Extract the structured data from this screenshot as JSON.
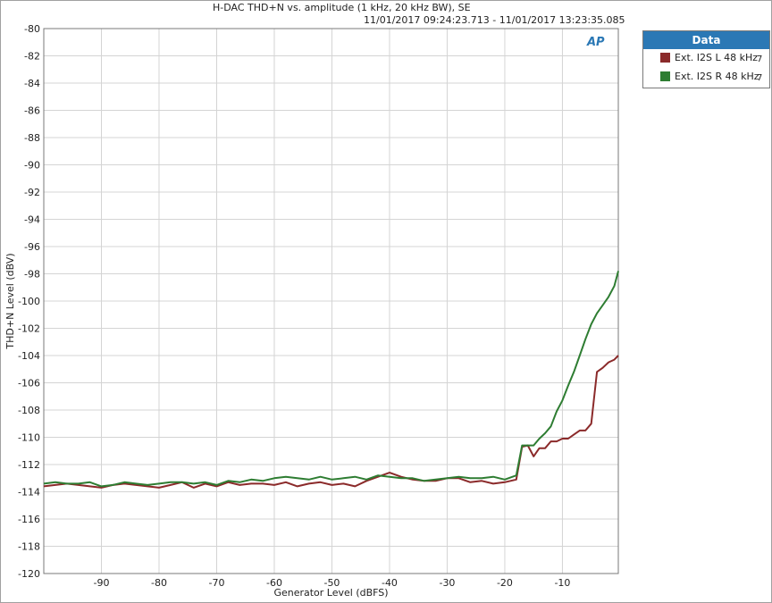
{
  "title": "H-DAC THD+N vs. amplitude (1 kHz, 20 kHz BW), SE",
  "subtitle": "11/01/2017 09:24:23.713 - 11/01/2017 13:23:35.085",
  "logo_text": "AP",
  "legend": {
    "header": "Data",
    "items": [
      {
        "label": "Ext. I2S L 48 kHz",
        "num": "7",
        "color": "#8b2a2a"
      },
      {
        "label": "Ext. I2S R 48 kHz",
        "num": "7",
        "color": "#2e7d32"
      }
    ]
  },
  "chart_data": {
    "type": "line",
    "title": "H-DAC THD+N vs. amplitude (1 kHz, 20 kHz BW), SE",
    "xlabel": "Generator Level (dBFS)",
    "ylabel": "THD+N Level (dBV)",
    "xlim": [
      -100,
      -0.3
    ],
    "ylim": [
      -120,
      -80
    ],
    "xticks": [
      -90,
      -80,
      -70,
      -60,
      -50,
      -40,
      -30,
      -20,
      -10
    ],
    "yticks": [
      -120,
      -118,
      -116,
      -114,
      -112,
      -110,
      -108,
      -106,
      -104,
      -102,
      -100,
      -98,
      -96,
      -94,
      -92,
      -90,
      -88,
      -86,
      -84,
      -82,
      -80
    ],
    "grid": true,
    "series": [
      {
        "name": "Ext. I2S L 48 kHz",
        "color": "#8b2a2a",
        "points": [
          [
            -100,
            -113.6
          ],
          [
            -98,
            -113.5
          ],
          [
            -96,
            -113.4
          ],
          [
            -94,
            -113.5
          ],
          [
            -92,
            -113.6
          ],
          [
            -90,
            -113.7
          ],
          [
            -88,
            -113.5
          ],
          [
            -86,
            -113.4
          ],
          [
            -84,
            -113.5
          ],
          [
            -82,
            -113.6
          ],
          [
            -80,
            -113.7
          ],
          [
            -78,
            -113.5
          ],
          [
            -76,
            -113.3
          ],
          [
            -74,
            -113.7
          ],
          [
            -72,
            -113.4
          ],
          [
            -70,
            -113.6
          ],
          [
            -68,
            -113.3
          ],
          [
            -66,
            -113.5
          ],
          [
            -64,
            -113.4
          ],
          [
            -62,
            -113.4
          ],
          [
            -60,
            -113.5
          ],
          [
            -58,
            -113.3
          ],
          [
            -56,
            -113.6
          ],
          [
            -54,
            -113.4
          ],
          [
            -52,
            -113.3
          ],
          [
            -50,
            -113.5
          ],
          [
            -48,
            -113.4
          ],
          [
            -46,
            -113.6
          ],
          [
            -44,
            -113.2
          ],
          [
            -42,
            -112.9
          ],
          [
            -40,
            -112.6
          ],
          [
            -38,
            -112.9
          ],
          [
            -36,
            -113.1
          ],
          [
            -34,
            -113.2
          ],
          [
            -32,
            -113.2
          ],
          [
            -30,
            -113.0
          ],
          [
            -28,
            -113.0
          ],
          [
            -26,
            -113.3
          ],
          [
            -24,
            -113.2
          ],
          [
            -22,
            -113.4
          ],
          [
            -20,
            -113.3
          ],
          [
            -18,
            -113.1
          ],
          [
            -17,
            -110.7
          ],
          [
            -16,
            -110.6
          ],
          [
            -15,
            -111.4
          ],
          [
            -14,
            -110.8
          ],
          [
            -13,
            -110.8
          ],
          [
            -12,
            -110.3
          ],
          [
            -11,
            -110.3
          ],
          [
            -10,
            -110.1
          ],
          [
            -9,
            -110.1
          ],
          [
            -8,
            -109.8
          ],
          [
            -7,
            -109.5
          ],
          [
            -6,
            -109.5
          ],
          [
            -5,
            -109.0
          ],
          [
            -4,
            -105.2
          ],
          [
            -3,
            -104.9
          ],
          [
            -2,
            -104.5
          ],
          [
            -1,
            -104.3
          ],
          [
            -0.3,
            -104.0
          ]
        ]
      },
      {
        "name": "Ext. I2S R 48 kHz",
        "color": "#2e7d32",
        "points": [
          [
            -100,
            -113.4
          ],
          [
            -98,
            -113.3
          ],
          [
            -96,
            -113.4
          ],
          [
            -94,
            -113.4
          ],
          [
            -92,
            -113.3
          ],
          [
            -90,
            -113.6
          ],
          [
            -88,
            -113.5
          ],
          [
            -86,
            -113.3
          ],
          [
            -84,
            -113.4
          ],
          [
            -82,
            -113.5
          ],
          [
            -80,
            -113.4
          ],
          [
            -78,
            -113.3
          ],
          [
            -76,
            -113.3
          ],
          [
            -74,
            -113.4
          ],
          [
            -72,
            -113.3
          ],
          [
            -70,
            -113.5
          ],
          [
            -68,
            -113.2
          ],
          [
            -66,
            -113.3
          ],
          [
            -64,
            -113.1
          ],
          [
            -62,
            -113.2
          ],
          [
            -60,
            -113.0
          ],
          [
            -58,
            -112.9
          ],
          [
            -56,
            -113.0
          ],
          [
            -54,
            -113.1
          ],
          [
            -52,
            -112.9
          ],
          [
            -50,
            -113.1
          ],
          [
            -48,
            -113.0
          ],
          [
            -46,
            -112.9
          ],
          [
            -44,
            -113.1
          ],
          [
            -42,
            -112.8
          ],
          [
            -40,
            -112.9
          ],
          [
            -38,
            -113.0
          ],
          [
            -36,
            -113.0
          ],
          [
            -34,
            -113.2
          ],
          [
            -32,
            -113.1
          ],
          [
            -30,
            -113.0
          ],
          [
            -28,
            -112.9
          ],
          [
            -26,
            -113.0
          ],
          [
            -24,
            -113.0
          ],
          [
            -22,
            -112.9
          ],
          [
            -20,
            -113.1
          ],
          [
            -18,
            -112.8
          ],
          [
            -17,
            -110.6
          ],
          [
            -16,
            -110.6
          ],
          [
            -15,
            -110.6
          ],
          [
            -14,
            -110.1
          ],
          [
            -13,
            -109.7
          ],
          [
            -12,
            -109.2
          ],
          [
            -11,
            -108.1
          ],
          [
            -10,
            -107.3
          ],
          [
            -9,
            -106.2
          ],
          [
            -8,
            -105.2
          ],
          [
            -7,
            -104.0
          ],
          [
            -6,
            -102.8
          ],
          [
            -5,
            -101.7
          ],
          [
            -4,
            -100.9
          ],
          [
            -3,
            -100.3
          ],
          [
            -2,
            -99.7
          ],
          [
            -1,
            -98.9
          ],
          [
            -0.3,
            -97.8
          ]
        ]
      }
    ]
  }
}
